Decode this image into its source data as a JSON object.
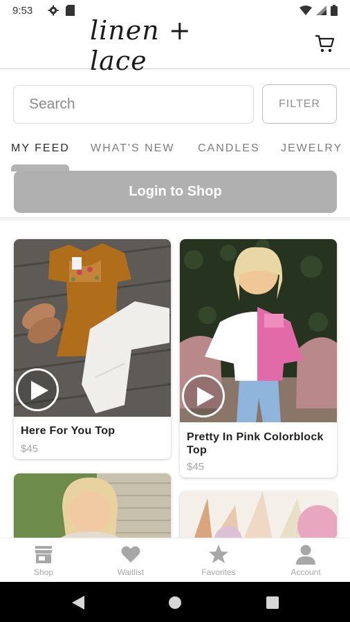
{
  "status_bar": {
    "time": "9:53"
  },
  "header": {
    "logo_text": "linen + lace"
  },
  "search": {
    "placeholder": "Search",
    "filter_label": "FILTER"
  },
  "tabs": [
    {
      "label": "MY FEED",
      "active": true
    },
    {
      "label": "WHAT'S NEW",
      "active": false
    },
    {
      "label": "CANDLES",
      "active": false
    },
    {
      "label": "JEWELRY",
      "active": false
    }
  ],
  "login_button": "Login to Shop",
  "products": [
    {
      "title": "Here For You Top",
      "price": "$45",
      "has_video": true
    },
    {
      "title": "Pretty In Pink Colorblock Top",
      "price": "$45",
      "has_video": true
    }
  ],
  "bottom_nav": [
    {
      "label": "Shop",
      "icon": "store-icon"
    },
    {
      "label": "Waitlist",
      "icon": "heart-icon"
    },
    {
      "label": "Favorites",
      "icon": "star-icon"
    },
    {
      "label": "Account",
      "icon": "account-icon"
    }
  ],
  "colors": {
    "login_bg": "#b0b0b0",
    "nav_icon": "#a7a7a7",
    "accent_pink": "#e26aa8"
  }
}
